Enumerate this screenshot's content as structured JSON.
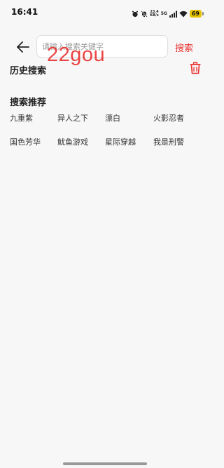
{
  "status_bar": {
    "time": "16:41",
    "net_speed_value": "23.4",
    "net_speed_unit": "KB/s",
    "network_type": "5G",
    "battery": "69"
  },
  "search": {
    "placeholder": "请输入搜索关键字",
    "submit_label": "搜索"
  },
  "watermark": "22gou",
  "history": {
    "title": "历史搜索"
  },
  "recommend": {
    "title": "搜索推荐",
    "rows": [
      [
        "九重紫",
        "异人之下",
        "漂白",
        "火影忍者"
      ],
      [
        "国色芳华",
        "鱿鱼游戏",
        "星际穿越",
        "我是刑警"
      ]
    ]
  },
  "colors": {
    "accent": "#e8312f",
    "background": "#f7f7f7"
  }
}
